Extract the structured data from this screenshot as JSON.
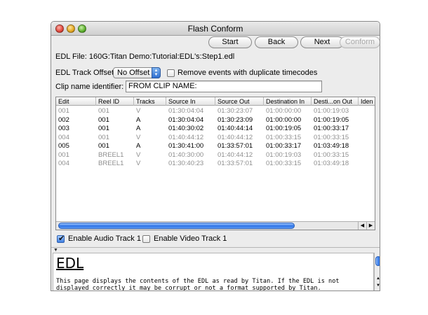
{
  "window": {
    "title": "Flash Conform"
  },
  "toolbar": {
    "start": "Start",
    "back": "Back",
    "next": "Next",
    "conform": "Conform"
  },
  "edl_file": {
    "label": "EDL File:",
    "value": "160G:Titan Demo:Tutorial:EDL's:Step1.edl"
  },
  "track_offset": {
    "label": "EDL Track Offset",
    "selected": "No Offset"
  },
  "remove_duplicates": {
    "label": "Remove events with duplicate timecodes",
    "checked": false
  },
  "clip_name": {
    "label": "Clip name identifier:",
    "value": "FROM CLIP NAME:"
  },
  "table": {
    "columns": [
      "Edit",
      "Reel ID",
      "Tracks",
      "Source In",
      "Source Out",
      "Destination In",
      "Desti...on Out",
      "Iden"
    ],
    "rows": [
      {
        "cells": [
          "001",
          "001",
          "V",
          "01:30:04:04",
          "01:30:23:07",
          "01:00:00:00",
          "01:00:19:03"
        ],
        "dim": true
      },
      {
        "cells": [
          "002",
          "001",
          "A",
          "01:30:04:04",
          "01:30:23:09",
          "01:00:00:00",
          "01:00:19:05"
        ],
        "dim": false
      },
      {
        "cells": [
          "003",
          "001",
          "A",
          "01:40:30:02",
          "01:40:44:14",
          "01:00:19:05",
          "01:00:33:17"
        ],
        "dim": false
      },
      {
        "cells": [
          "004",
          "001",
          "V",
          "01:40:44:12",
          "01:40:44:12",
          "01:00:33:15",
          "01:00:33:15"
        ],
        "dim": true
      },
      {
        "cells": [
          "005",
          "001",
          "A",
          "01:30:41:00",
          "01:33:57:01",
          "01:00:33:17",
          "01:03:49:18"
        ],
        "dim": false
      },
      {
        "cells": [
          "001",
          "BREEL1",
          "V",
          "01:40:30:00",
          "01:40:44:12",
          "01:00:19:03",
          "01:00:33:15"
        ],
        "dim": true
      },
      {
        "cells": [
          "004",
          "BREEL1",
          "V",
          "01:30:40:23",
          "01:33:57:01",
          "01:00:33:15",
          "01:03:49:18"
        ],
        "dim": true
      }
    ]
  },
  "enable_audio": {
    "label": "Enable Audio Track 1",
    "checked": true
  },
  "enable_video": {
    "label": "Enable Video Track 1",
    "checked": false
  },
  "help": {
    "title": "EDL",
    "body": "This page displays the contents of the EDL as read by Titan. If the EDL is not displayed correctly it may be corrupt or not a format supported by Titan."
  }
}
